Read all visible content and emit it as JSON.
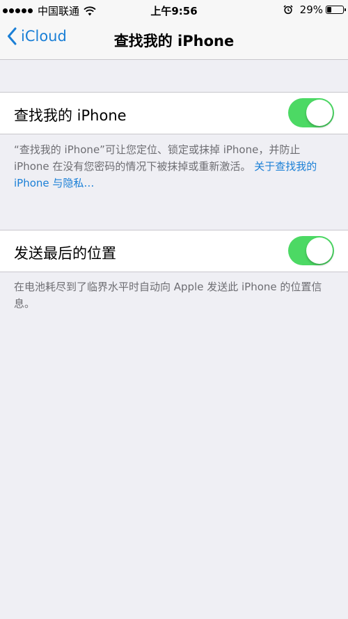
{
  "status_bar": {
    "carrier": "中国联通",
    "time": "上午9:56",
    "battery_percent": "29%",
    "battery_level": 0.29,
    "icons": [
      "signal-dots",
      "wifi-icon",
      "alarm-icon",
      "battery-icon"
    ]
  },
  "nav": {
    "back_label": "iCloud",
    "title": "查找我的 iPhone"
  },
  "find_iphone": {
    "label": "查找我的 iPhone",
    "enabled": true,
    "description": "“查找我的 iPhone”可让您定位、锁定或抹掉 iPhone，并防止 iPhone 在没有您密码的情况下被抹掉或重新激活。",
    "link": "关于查找我的 iPhone 与隐私…"
  },
  "send_last_location": {
    "label": "发送最后的位置",
    "enabled": true,
    "description": "在电池耗尽到了临界水平时自动向 Apple 发送此 iPhone 的位置信息。"
  },
  "colors": {
    "accent": "#1a7fd6",
    "toggle_on": "#4cd964",
    "background": "#efeff4",
    "footer_text": "#6d6d72"
  }
}
